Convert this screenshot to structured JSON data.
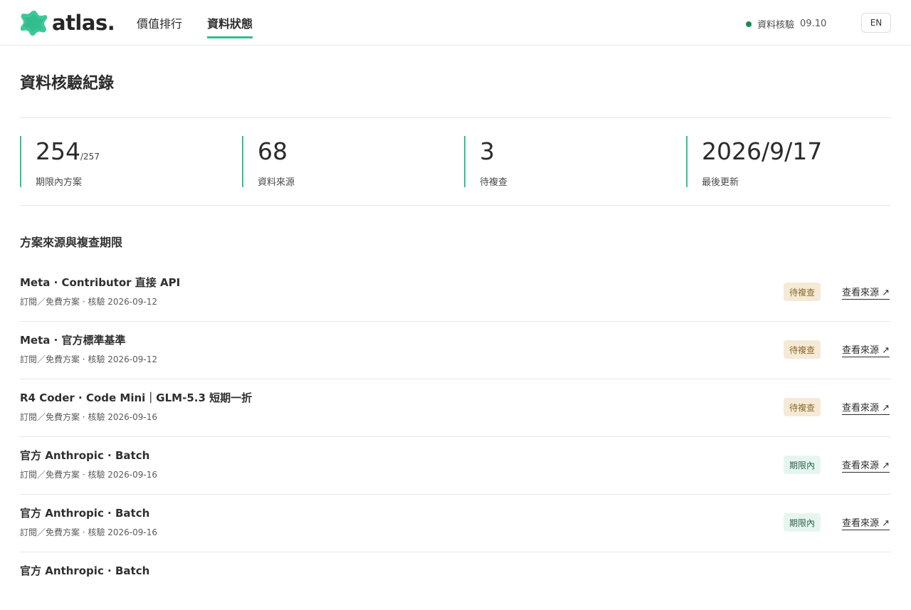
{
  "header": {
    "logo_text": "atlas.",
    "nav": [
      {
        "label": "價值排行",
        "active": false
      },
      {
        "label": "資料狀態",
        "active": true
      }
    ],
    "status": {
      "label": "資料核驗",
      "time": "09.10",
      "color": "#178a57"
    },
    "lang_button": "EN"
  },
  "page": {
    "title": "資料核驗紀錄"
  },
  "stats": [
    {
      "value": "254",
      "sub": "/257",
      "label": "期限內方案"
    },
    {
      "value": "68",
      "sub": "",
      "label": "資料來源"
    },
    {
      "value": "3",
      "sub": "",
      "label": "待複查"
    },
    {
      "value": "2026/9/17",
      "sub": "",
      "label": "最後更新"
    }
  ],
  "section": {
    "title": "方案來源與複查期限"
  },
  "rows": [
    {
      "title": "Meta · Contributor 直接 API",
      "meta": "訂閱／免費方案 · 核驗 2026-09-12",
      "badge": "待複查",
      "badge_type": "pending",
      "link": "查看來源 ↗"
    },
    {
      "title": "Meta · 官方標準基準",
      "meta": "訂閱／免費方案 · 核驗 2026-09-12",
      "badge": "待複查",
      "badge_type": "pending",
      "link": "查看來源 ↗"
    },
    {
      "title": "R4 Coder · Code Mini｜GLM-5.3 短期一折",
      "meta": "訂閱／免費方案 · 核驗 2026-09-16",
      "badge": "待複查",
      "badge_type": "pending",
      "link": "查看來源 ↗"
    },
    {
      "title": "官方 Anthropic · Batch",
      "meta": "訂閱／免費方案 · 核驗 2026-09-16",
      "badge": "期限內",
      "badge_type": "valid",
      "link": "查看來源 ↗"
    },
    {
      "title": "官方 Anthropic · Batch",
      "meta": "訂閱／免費方案 · 核驗 2026-09-16",
      "badge": "期限內",
      "badge_type": "valid",
      "link": "查看來源 ↗"
    },
    {
      "title": "官方 Anthropic · Batch",
      "meta": "",
      "badge": "",
      "badge_type": "valid",
      "link": ""
    }
  ],
  "colors": {
    "accent": "#2fbf92",
    "pending_bg": "#f5ead6",
    "valid_bg": "#e6f6ef"
  }
}
